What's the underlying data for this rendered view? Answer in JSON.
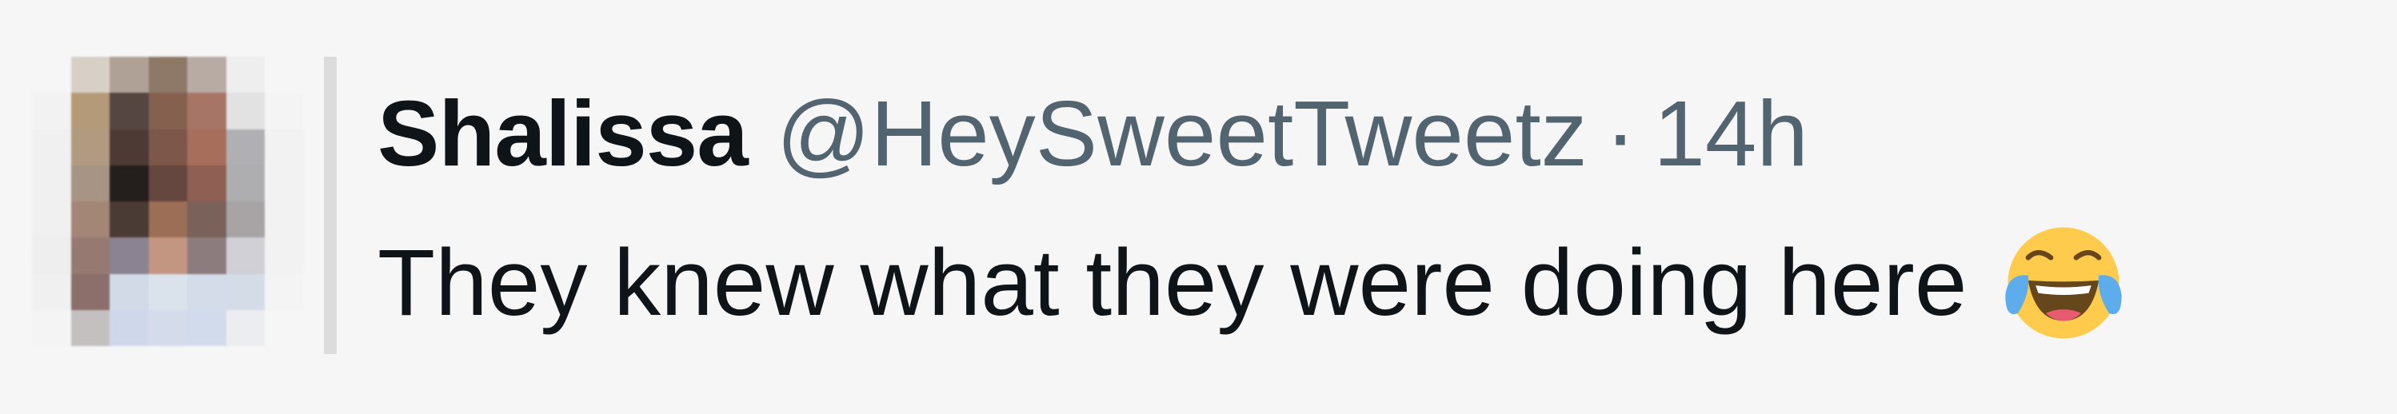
{
  "tweet": {
    "display_name": "Shalissa",
    "handle": "@HeySweetTweetz",
    "separator": "·",
    "time": "14h",
    "text": "They knew what they were doing here",
    "emoji_icon": "face-with-tears-of-joy-icon"
  },
  "colors": {
    "background": "#f6f6f6",
    "name_text": "#0f1419",
    "secondary_text": "#536471",
    "quote_bar": "#dcdcdc"
  },
  "avatar": {
    "icon": "pixelated-avatar-icon",
    "pixels": [
      [
        "#f6f6f6",
        "#d8d0c6",
        "#b0a196",
        "#8e7868",
        "#b8aba4",
        "#eeeeee",
        "#f6f6f6"
      ],
      [
        "#f2f2f2",
        "#b49a78",
        "#564641",
        "#85604f",
        "#a67565",
        "#e2e2e2",
        "#f4f4f4"
      ],
      [
        "#f0f0f0",
        "#b29a80",
        "#4d3a34",
        "#7c574a",
        "#a86e5c",
        "#b0b0b4",
        "#f2f2f2"
      ],
      [
        "#f0f0f0",
        "#a89484",
        "#241f1d",
        "#65473f",
        "#8e5f52",
        "#aeaeb0",
        "#f2f2f2"
      ],
      [
        "#f0f0f0",
        "#a48676",
        "#4b3b35",
        "#9c6e56",
        "#7a615a",
        "#a6a4a4",
        "#f2f2f2"
      ],
      [
        "#eeeeee",
        "#967a71",
        "#8b8391",
        "#c39682",
        "#8c7c7e",
        "#d0d0d6",
        "#f2f2f2"
      ],
      [
        "#f0f0f0",
        "#8c6e6b",
        "#d2dae8",
        "#dae2ec",
        "#d4dcea",
        "#d4dce8",
        "#f4f4f4"
      ],
      [
        "#f4f4f4",
        "#c4c0c0",
        "#cfd8ea",
        "#d4dcec",
        "#d2dbec",
        "#ecedf1",
        "#f6f6f6"
      ]
    ]
  }
}
